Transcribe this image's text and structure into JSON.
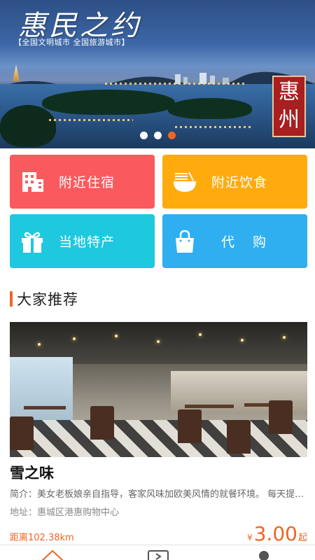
{
  "banner": {
    "title": "惠民之约",
    "subtitle": "【全国文明城市  全国旅游城市】",
    "seal_chars": [
      "惠",
      "州"
    ],
    "slides": 3,
    "active_slide": 3
  },
  "categories": [
    {
      "label": "附近住宿",
      "icon": "building-icon",
      "color": "#fa5a5e"
    },
    {
      "label": "附近饮食",
      "icon": "noodle-bowl-icon",
      "color": "#ffab0d"
    },
    {
      "label": "当地特产",
      "icon": "gift-icon",
      "color": "#1ec8de"
    },
    {
      "label": "代 购",
      "icon": "shopping-bag-icon",
      "color": "#2faff0"
    }
  ],
  "section": {
    "title": "大家推荐",
    "accent": "#f06524"
  },
  "recommendation": {
    "name": "雪之味",
    "intro": "简介：美女老板娘亲自指导，客家风味加欧美风情的就餐环境。 每天提供新鲜美食",
    "address": "地址：惠城区港惠购物中心",
    "distance": "距离102.38km",
    "price_currency": "¥",
    "price_amount": "3.00",
    "price_suffix": "起"
  },
  "bottom_nav": {
    "items": [
      "home-icon",
      "media-icon",
      "profile-icon"
    ],
    "active_color": "#f06524"
  }
}
